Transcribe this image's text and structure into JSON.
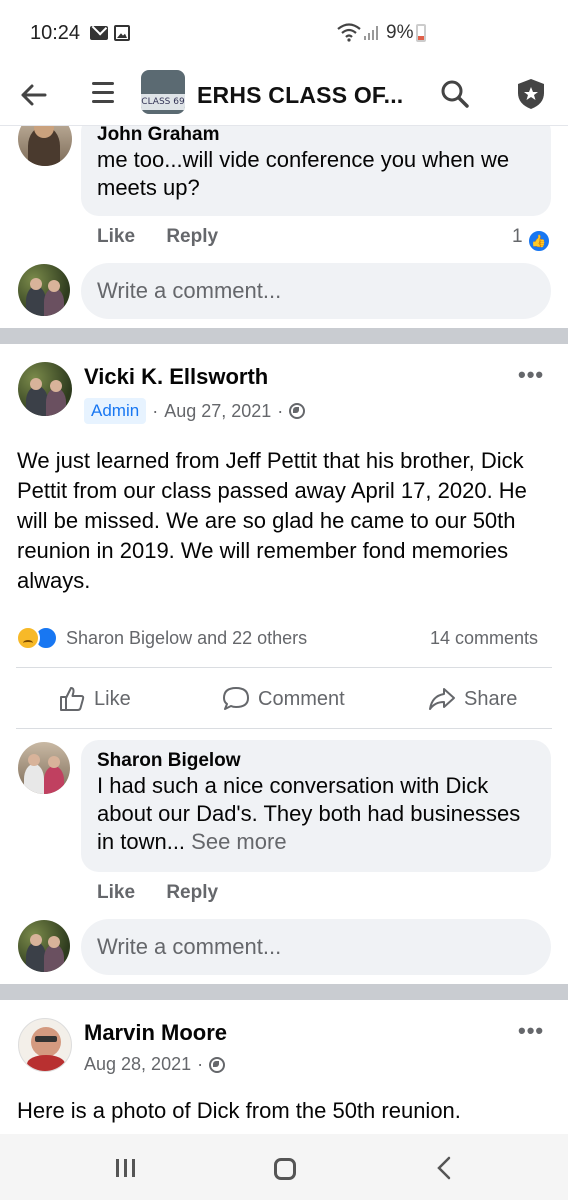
{
  "status_bar": {
    "time": "10:24",
    "battery": "9%"
  },
  "app_bar": {
    "group_name": "ERHS CLASS OF...",
    "thumb_plate": "CLASS 69"
  },
  "comment1": {
    "author": "John Graham",
    "text": "me too...will vide conference you when we meets up?",
    "like_label": "Like",
    "reply_label": "Reply",
    "like_count": "1"
  },
  "write_comment_1": {
    "placeholder": "Write a comment..."
  },
  "post1": {
    "author": "Vicki K. Ellsworth",
    "badge": "Admin",
    "date": "Aug 27, 2021",
    "body": "We just learned from Jeff Pettit that his brother, Dick Pettit from our class passed away April 17, 2020. He will be missed. We are so glad he came to our 50th reunion in 2019. We will remember fond memories always.",
    "reactions_text": "Sharon Bigelow and 22 others",
    "comments_text": "14 comments",
    "actions": {
      "like": "Like",
      "comment": "Comment",
      "share": "Share"
    },
    "top_comment": {
      "author": "Sharon Bigelow",
      "text": "I had such a nice conversation with Dick about our Dad's. They both had businesses in town...",
      "see_more": "See more",
      "like_label": "Like",
      "reply_label": "Reply"
    },
    "write_comment": {
      "placeholder": "Write a comment..."
    }
  },
  "post2": {
    "author": "Marvin Moore",
    "date": "Aug 28, 2021",
    "body": "Here is a photo of Dick from the 50th reunion."
  },
  "colors": {
    "accent": "#1877f2",
    "muted": "#65676b",
    "bubble": "#f0f2f5",
    "divider": "#c9ccd1"
  }
}
